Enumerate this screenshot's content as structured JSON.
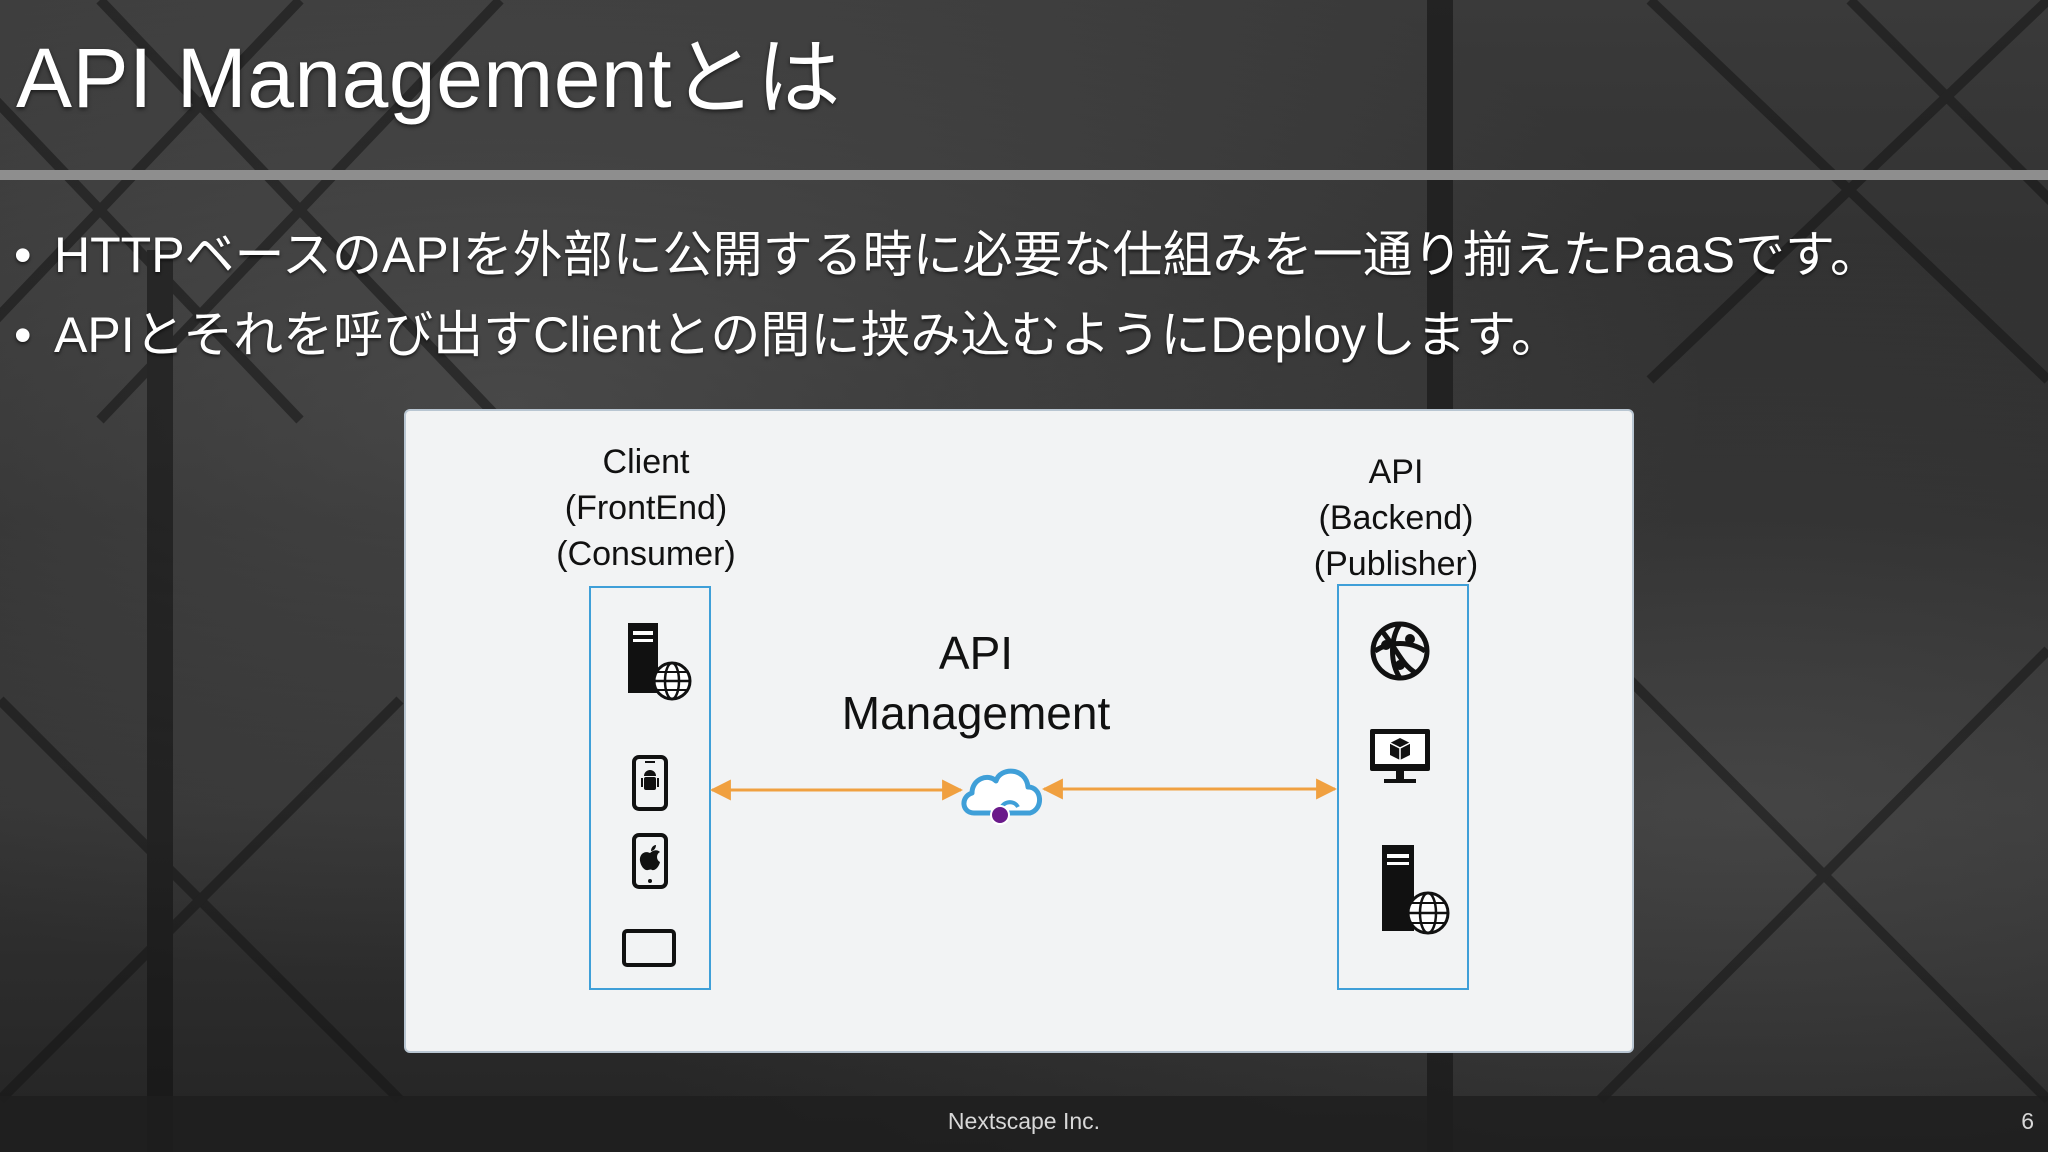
{
  "slide": {
    "title": "API Managementとは",
    "bullets": [
      {
        "marker": "•",
        "text": "HTTPベースのAPIを外部に公開する時に必要な仕組みを一通り揃えたPaaSです。"
      },
      {
        "marker": "•",
        "text": "APIとそれを呼び出すClientとの間に挟み込むようにDeployします。"
      }
    ]
  },
  "diagram": {
    "client": {
      "label_lines": [
        "Client",
        "(FrontEnd)",
        "(Consumer)"
      ],
      "icons": [
        "web-server-icon",
        "android-phone-icon",
        "apple-phone-icon",
        "tablet-icon"
      ]
    },
    "api_management": {
      "label_lines": [
        "API",
        "Management"
      ],
      "icon": "api-management-cloud-icon"
    },
    "api": {
      "label_lines": [
        "API",
        "(Backend)",
        "(Publisher)"
      ],
      "icons": [
        "web-app-icon",
        "virtual-machine-icon",
        "web-server-icon"
      ]
    },
    "colors": {
      "arrow": "#f0a040",
      "group_border": "#3f9fd8",
      "cloud_outline": "#3f9fd8",
      "cloud_dot": "#6a1a8a"
    }
  },
  "footer": {
    "company": "Nextscape Inc.",
    "page_number": "6"
  }
}
